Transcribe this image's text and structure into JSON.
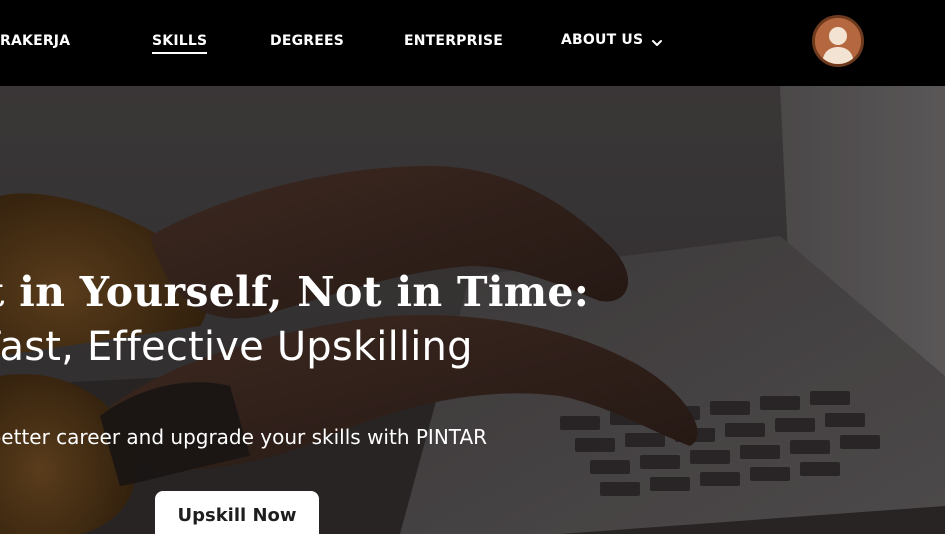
{
  "nav": {
    "brand": "RAKERJA",
    "links": [
      {
        "label": "SKILLS",
        "active": true
      },
      {
        "label": "DEGREES"
      },
      {
        "label": "ENTERPRISE"
      },
      {
        "label": "ABOUT US",
        "has_dropdown": true
      }
    ],
    "avatar_icon": "user-avatar-icon"
  },
  "hero": {
    "title": "st in Yourself, Not in Time:",
    "subtitle": "Fast, Effective Upskilling",
    "tagline": "a better career and upgrade your skills with PINTAR",
    "cta_label": "Upskill Now",
    "background_image": "hands-typing-on-laptop"
  },
  "colors": {
    "nav_background": "#000000",
    "text": "#ffffff",
    "button_background": "#ffffff",
    "button_text": "#1e1e1e",
    "avatar_fill": "#b5673f"
  }
}
